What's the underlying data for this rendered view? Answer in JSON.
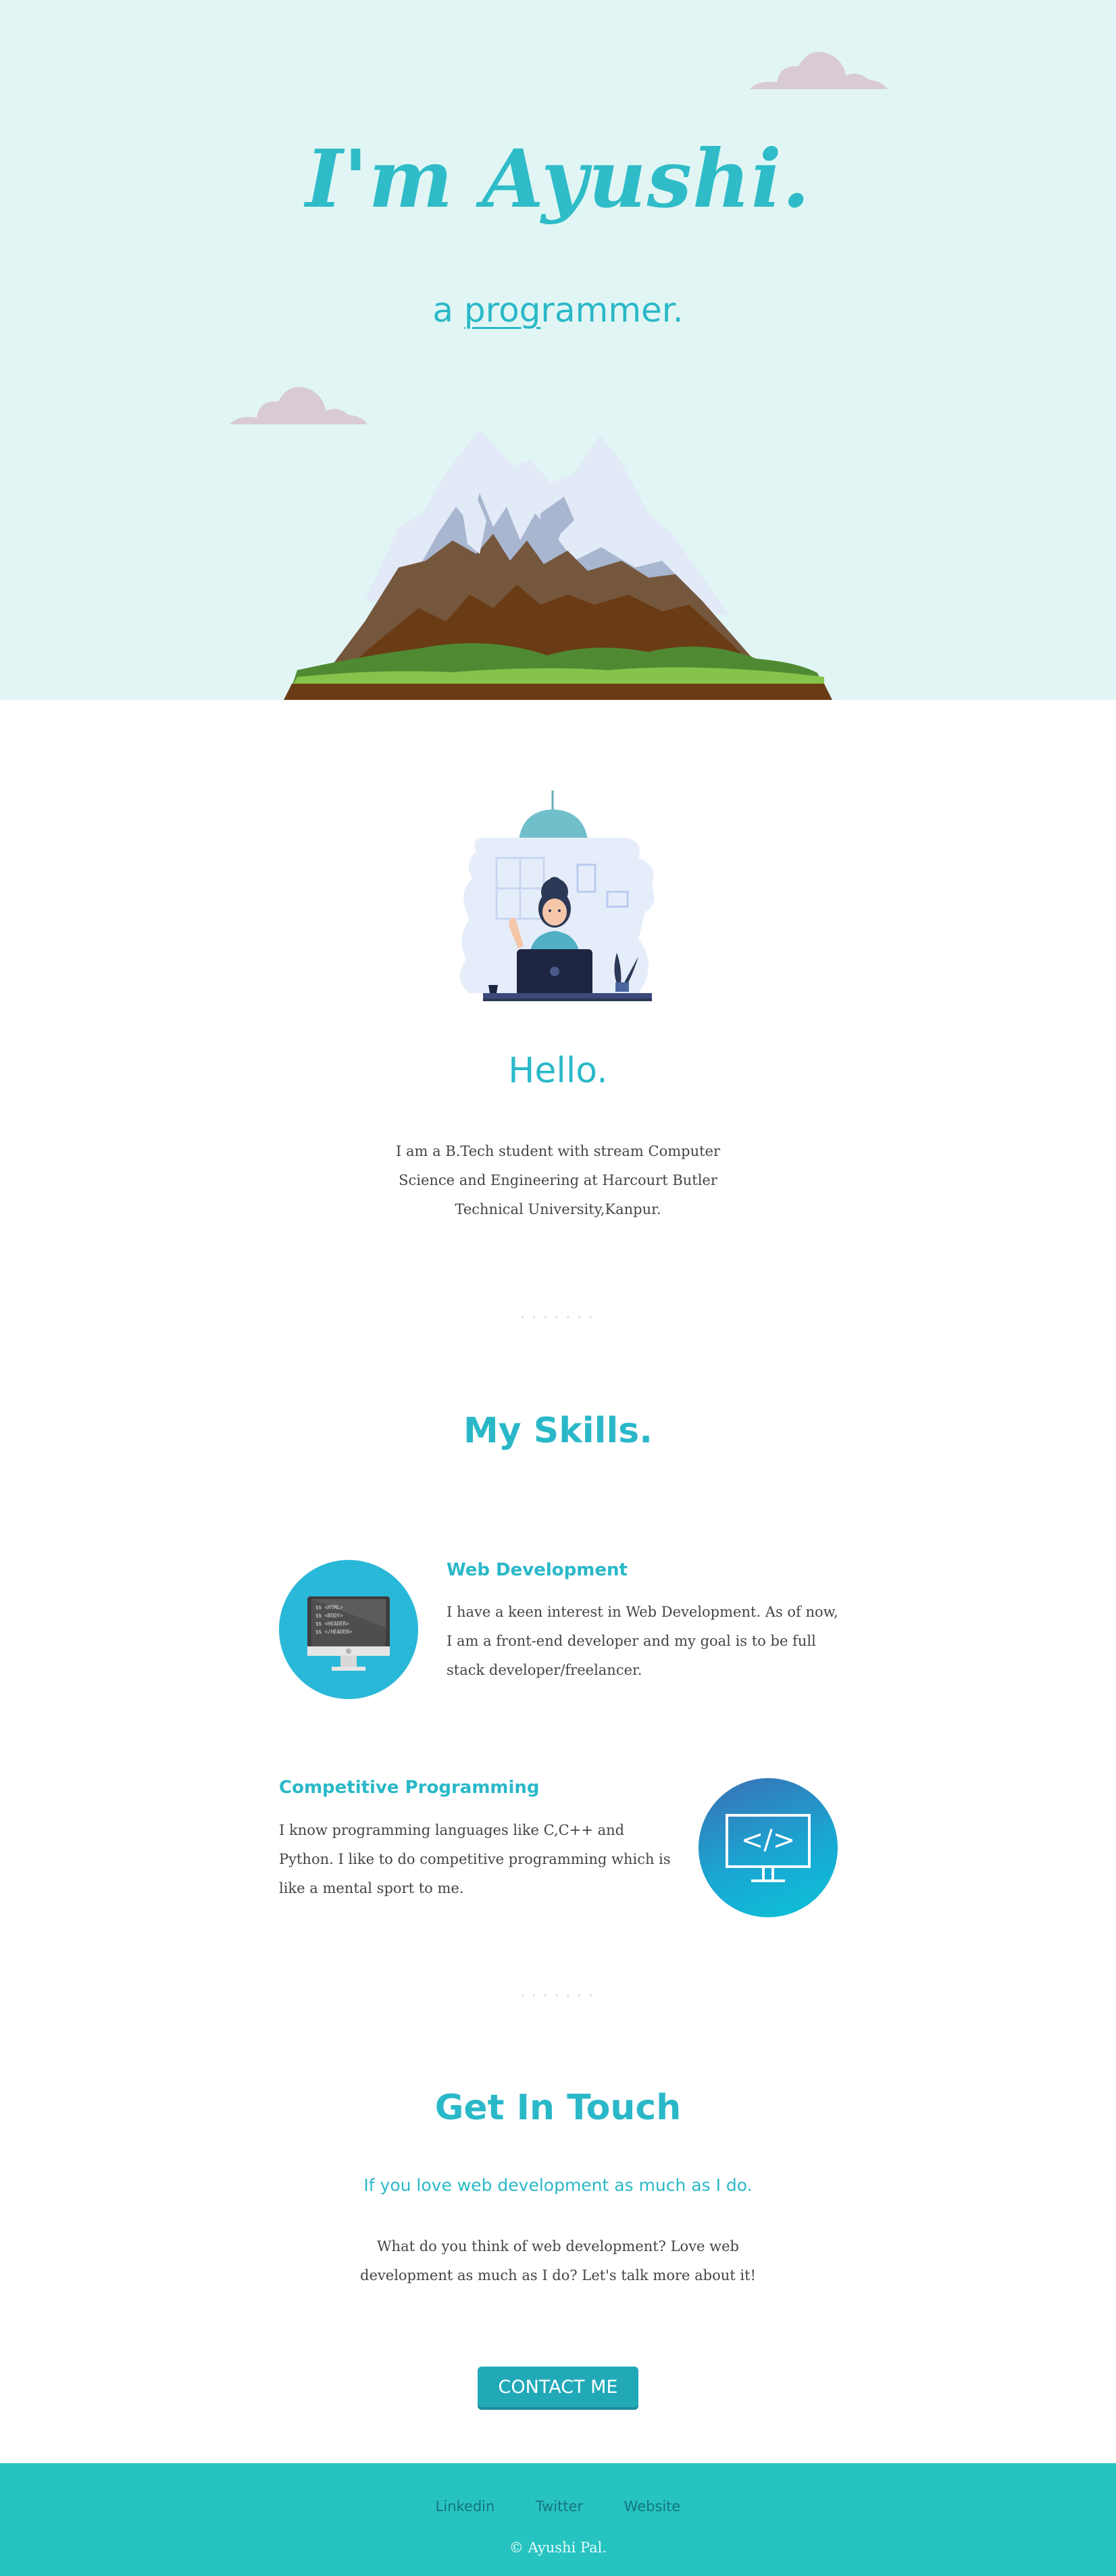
{
  "hero": {
    "name": "I'm Ayushi.",
    "subtitle_prefix": "a ",
    "subtitle_underlined": "prog",
    "subtitle_suffix": "rammer."
  },
  "about": {
    "title": "Hello.",
    "text": "I am a B.Tech student with stream Computer Science and Engineering at Harcourt Butler Technical University,Kanpur."
  },
  "separator": "• • • • • • •",
  "skills": {
    "title": "My Skills.",
    "items": [
      {
        "title": "Web Development",
        "text": "I have a keen interest in Web Development. As of now, I am a front-end developer and my goal is to be full stack developer/freelancer.",
        "monitor_lines": [
          "$$ <HTML>",
          "$$ <BODY>",
          "$$ <HEADER>",
          "$$ </HEADER>"
        ]
      },
      {
        "title": "Competitive Programming",
        "text": "I know programming languages like C,C++ and Python. I like to do competitive programming which is like a mental sport to me.",
        "icon_text": "</>"
      }
    ]
  },
  "contact": {
    "title": "Get In Touch",
    "subtitle": "If you love web development as much as I do.",
    "text": "What do you think of web development? Love web development as much as I do? Let's talk more about it!",
    "button": "CONTACT ME"
  },
  "footer": {
    "links": [
      "Linkedin",
      "Twitter",
      "Website"
    ],
    "copyright": "© Ayushi Pal."
  },
  "colors": {
    "accent": "#2ab8c8",
    "hero_bg": "#e1f6f4",
    "footer_bg": "#27c3c1",
    "button_bg": "#21a9b8"
  }
}
